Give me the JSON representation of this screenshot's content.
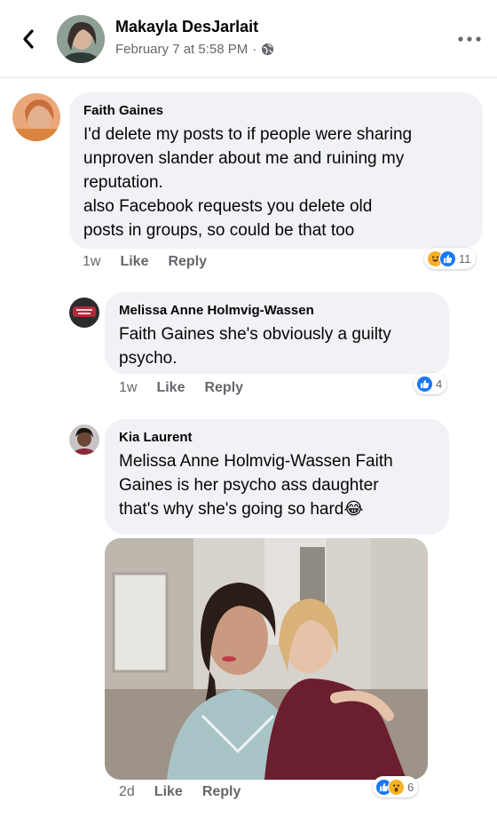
{
  "header": {
    "poster_name": "Makayla DesJarlait",
    "timestamp": "February 7 at 5:58 PM",
    "separator": "·",
    "privacy_icon": "globe-icon",
    "back_icon": "chevron-left-icon",
    "more_icon": "more-horizontal-icon"
  },
  "comments": [
    {
      "author": "Faith Gaines",
      "text": "I'd delete my posts to if people were sharing\nunproven slander about me and ruining my\nreputation.\nalso Facebook requests you delete old\nposts in groups, so could be that too",
      "time": "1w",
      "like_label": "Like",
      "reply_label": "Reply",
      "reactions": [
        "haha",
        "like"
      ],
      "reaction_count": "11"
    },
    {
      "author": "Melissa Anne Holmvig-Wassen",
      "text": "Faith Gaines she's obviously a guilty\npsycho.",
      "time": "1w",
      "like_label": "Like",
      "reply_label": "Reply",
      "reactions": [
        "like"
      ],
      "reaction_count": "4"
    },
    {
      "author": "Kia Laurent",
      "text": "Melissa Anne Holmvig-Wassen Faith\nGaines is her psycho ass daughter\nthat's why she's going so hard",
      "emoji": "😂",
      "time": "2d",
      "like_label": "Like",
      "reply_label": "Reply",
      "reactions": [
        "like",
        "wow"
      ],
      "reaction_count": "6",
      "has_photo": true
    }
  ],
  "colors": {
    "bubble": "#f0f2f5",
    "secondary_text": "#65676b",
    "like_blue": "#1877f2",
    "haha_yellow": "#f7b125"
  }
}
